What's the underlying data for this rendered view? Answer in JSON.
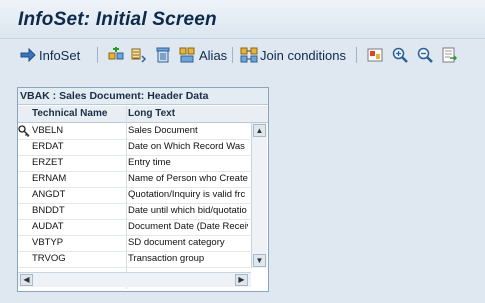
{
  "screen": {
    "title": "InfoSet: Initial Screen"
  },
  "toolbar": {
    "infoset_label": "InfoSet",
    "alias_label": "Alias",
    "join_label": "Join conditions",
    "icons": [
      "arrow-right-icon",
      "insert-table-icon",
      "table-fields-icon",
      "delete-trash-icon",
      "alias-icon",
      "join-conditions-icon",
      "layout-icon",
      "zoom-in-icon",
      "zoom-out-icon",
      "export-icon"
    ]
  },
  "table_panel": {
    "title": "VBAK : Sales Document: Header Data",
    "headers": [
      "Technical Name",
      "Long Text"
    ],
    "rows": [
      {
        "tech": "VBELN",
        "text": "Sales Document",
        "key": true
      },
      {
        "tech": "ERDAT",
        "text": "Date on Which Record Was C"
      },
      {
        "tech": "ERZET",
        "text": "Entry time"
      },
      {
        "tech": "ERNAM",
        "text": "Name of Person who Create"
      },
      {
        "tech": "ANGDT",
        "text": "Quotation/Inquiry is valid frc"
      },
      {
        "tech": "BNDDT",
        "text": "Date until which bid/quotatio"
      },
      {
        "tech": "AUDAT",
        "text": "Document Date (Date Receiv"
      },
      {
        "tech": "VBTYP",
        "text": "SD document category"
      },
      {
        "tech": "TRVOG",
        "text": "Transaction group"
      }
    ]
  }
}
